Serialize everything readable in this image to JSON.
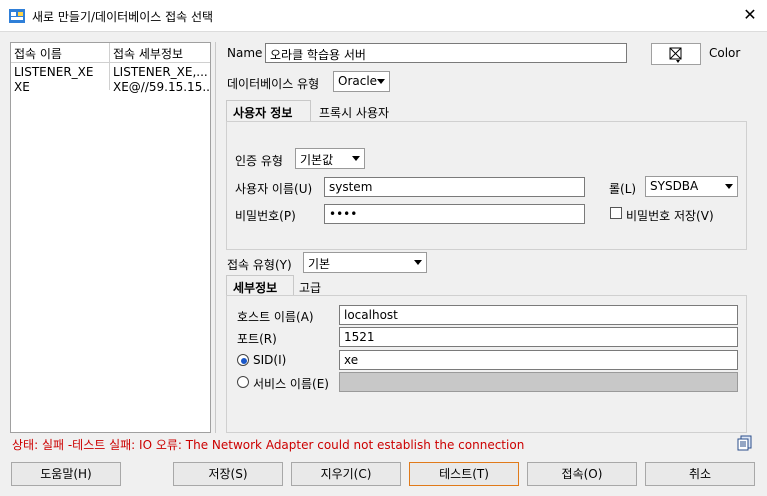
{
  "window": {
    "title": "새로 만들기/데이터베이스 접속 선택",
    "close_label": "✕",
    "app_icon": "database-connection-icon"
  },
  "connections": {
    "headers": [
      "접속 이름",
      "접속 세부정보"
    ],
    "rows": [
      [
        "LISTENER_XE",
        "LISTENER_XE,..."
      ],
      [
        "XE",
        "XE@//59.15.15...."
      ]
    ]
  },
  "form": {
    "name_label": "Name",
    "name_value": "오라클 학습용 서버",
    "color_label": "Color",
    "color_icon": "color-picker-icon",
    "dbtype_label": "데이터베이스 유형",
    "dbtype_value": "Oracle",
    "tabs": [
      "사용자 정보",
      "프록시 사용자"
    ],
    "auth_label": "인증 유형",
    "auth_value": "기본값",
    "user_label": "사용자 이름(U)",
    "user_value": "system",
    "role_label": "롤(L)",
    "role_value": "SYSDBA",
    "pw_label": "비밀번호(P)",
    "pw_value": "••••",
    "save_pw_label": "비밀번호 저장(V)",
    "conntype_label": "접속 유형(Y)",
    "conntype_value": "기본",
    "detail_tabs": [
      "세부정보",
      "고급"
    ],
    "host_label": "호스트 이름(A)",
    "host_value": "localhost",
    "port_label": "포트(R)",
    "port_value": "1521",
    "sid_label": "SID(I)",
    "sid_value": "xe",
    "service_label": "서비스 이름(E)"
  },
  "status": "상태: 실패 -테스트 실패: IO 오류: The Network Adapter could not establish the connection",
  "buttons": {
    "help": "도움말(H)",
    "save": "저장(S)",
    "clear": "지우기(C)",
    "test": "테스트(T)",
    "connect": "접속(O)",
    "cancel": "취소"
  },
  "colors": {
    "status_error": "#cc0000",
    "focus_border": "#e07a1a",
    "radio_selected": "#1a57c8"
  }
}
